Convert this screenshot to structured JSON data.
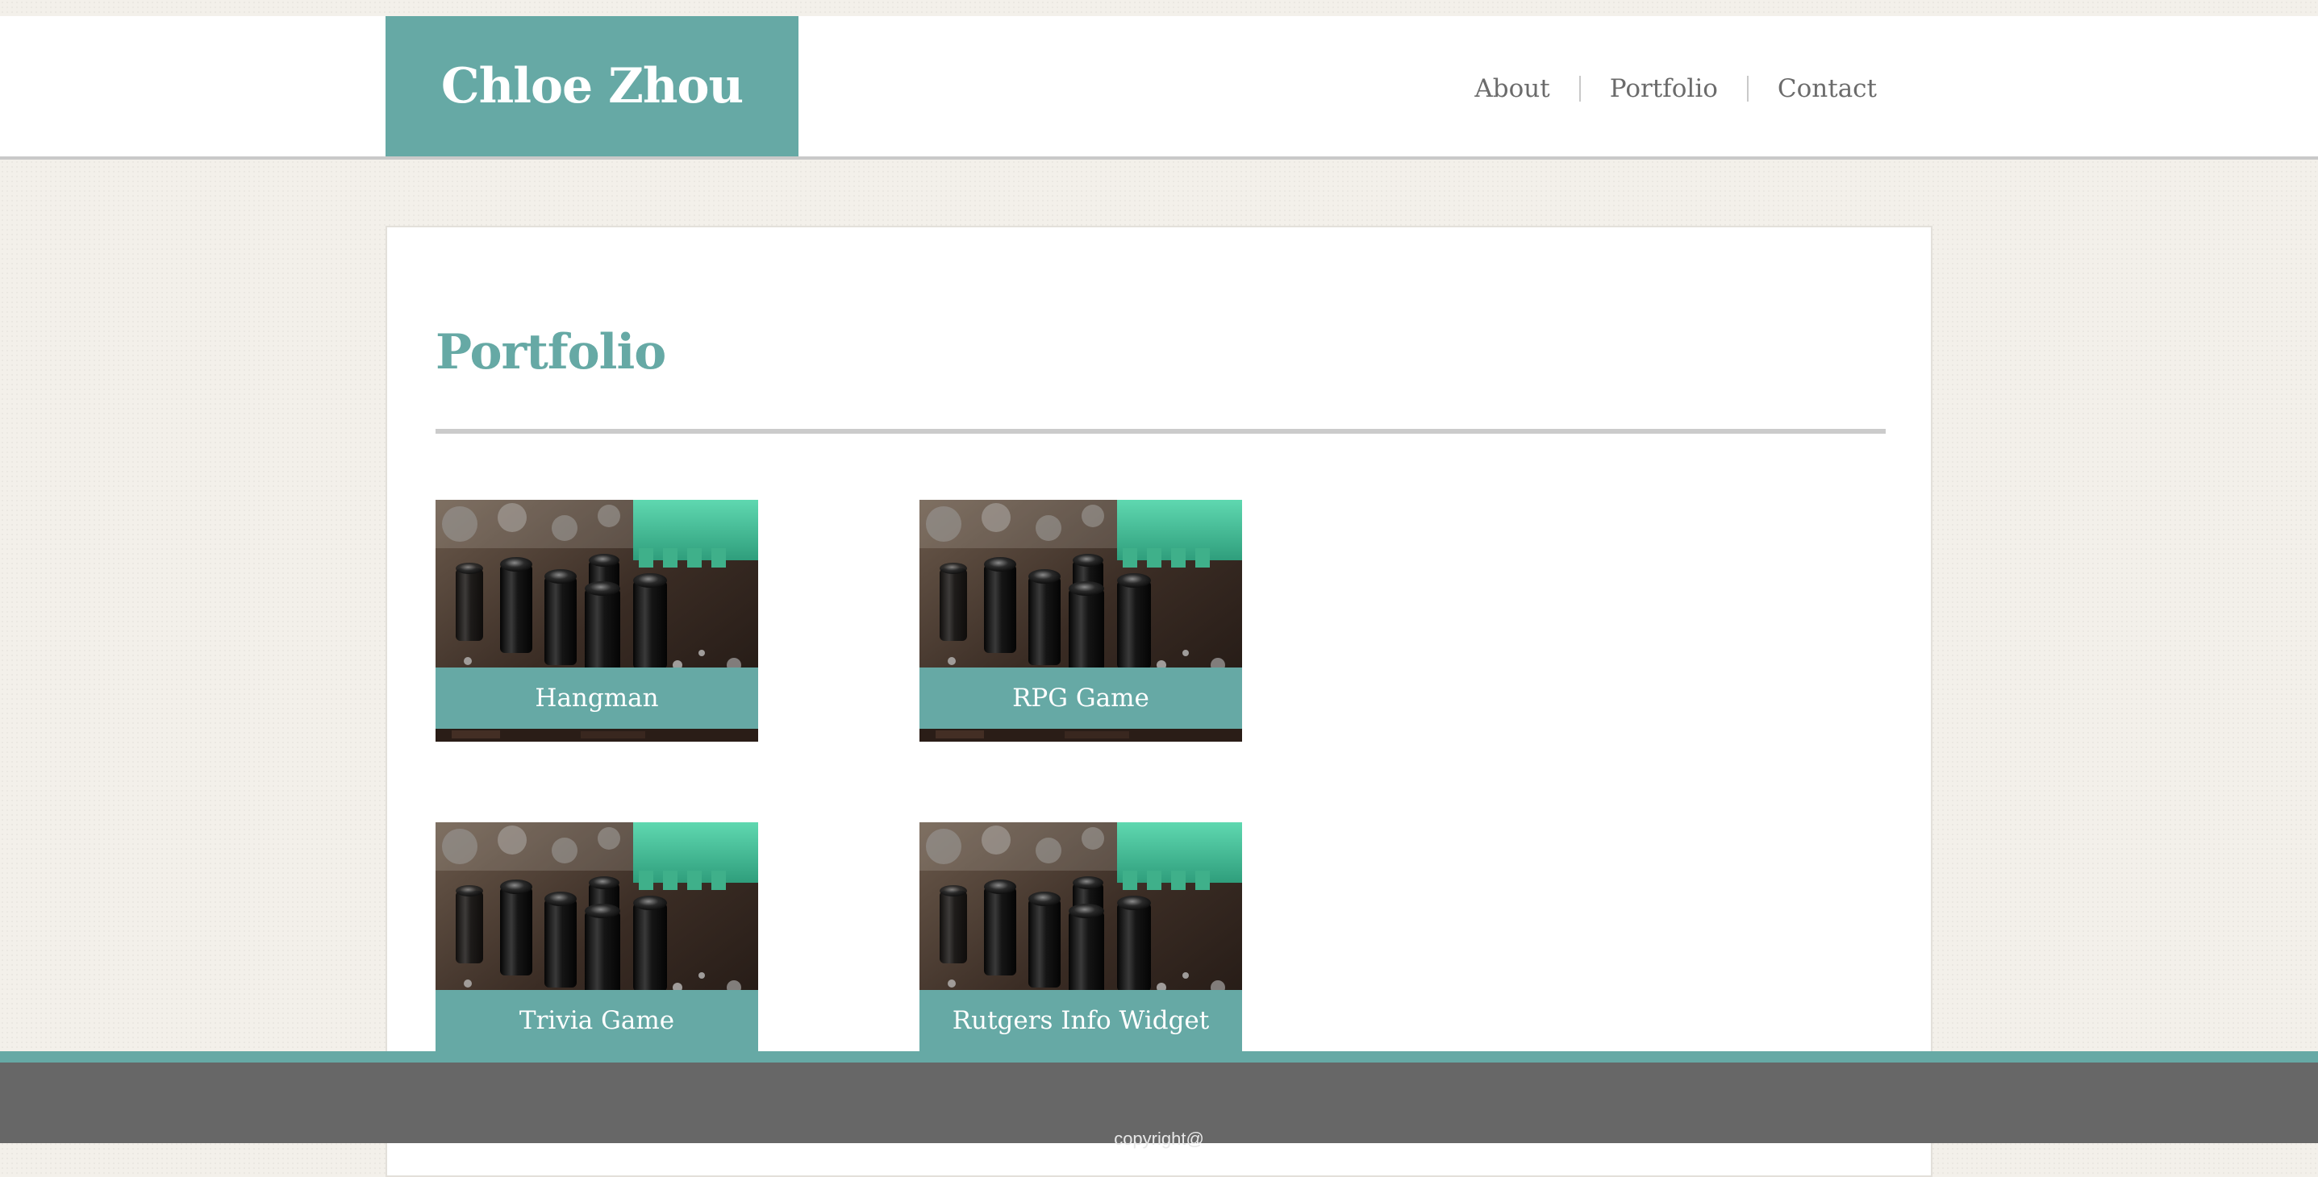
{
  "header": {
    "brand": "Chloe Zhou",
    "nav": [
      {
        "label": "About"
      },
      {
        "label": "Portfolio"
      },
      {
        "label": "Contact"
      }
    ]
  },
  "main": {
    "title": "Portfolio",
    "projects": [
      {
        "label": "Hangman",
        "image": "circuit-board-photo"
      },
      {
        "label": "RPG Game",
        "image": "circuit-board-photo"
      },
      {
        "label": "Trivia Game",
        "image": "circuit-board-photo"
      },
      {
        "label": "Rutgers Info Widget",
        "image": "circuit-board-photo"
      }
    ]
  },
  "footer": {
    "copyright": "copyright@"
  },
  "colors": {
    "accent": "#66a9a5",
    "nav_text": "#6b6b6b",
    "footer_bg": "#676767",
    "page_bg": "#f3f0ea"
  }
}
